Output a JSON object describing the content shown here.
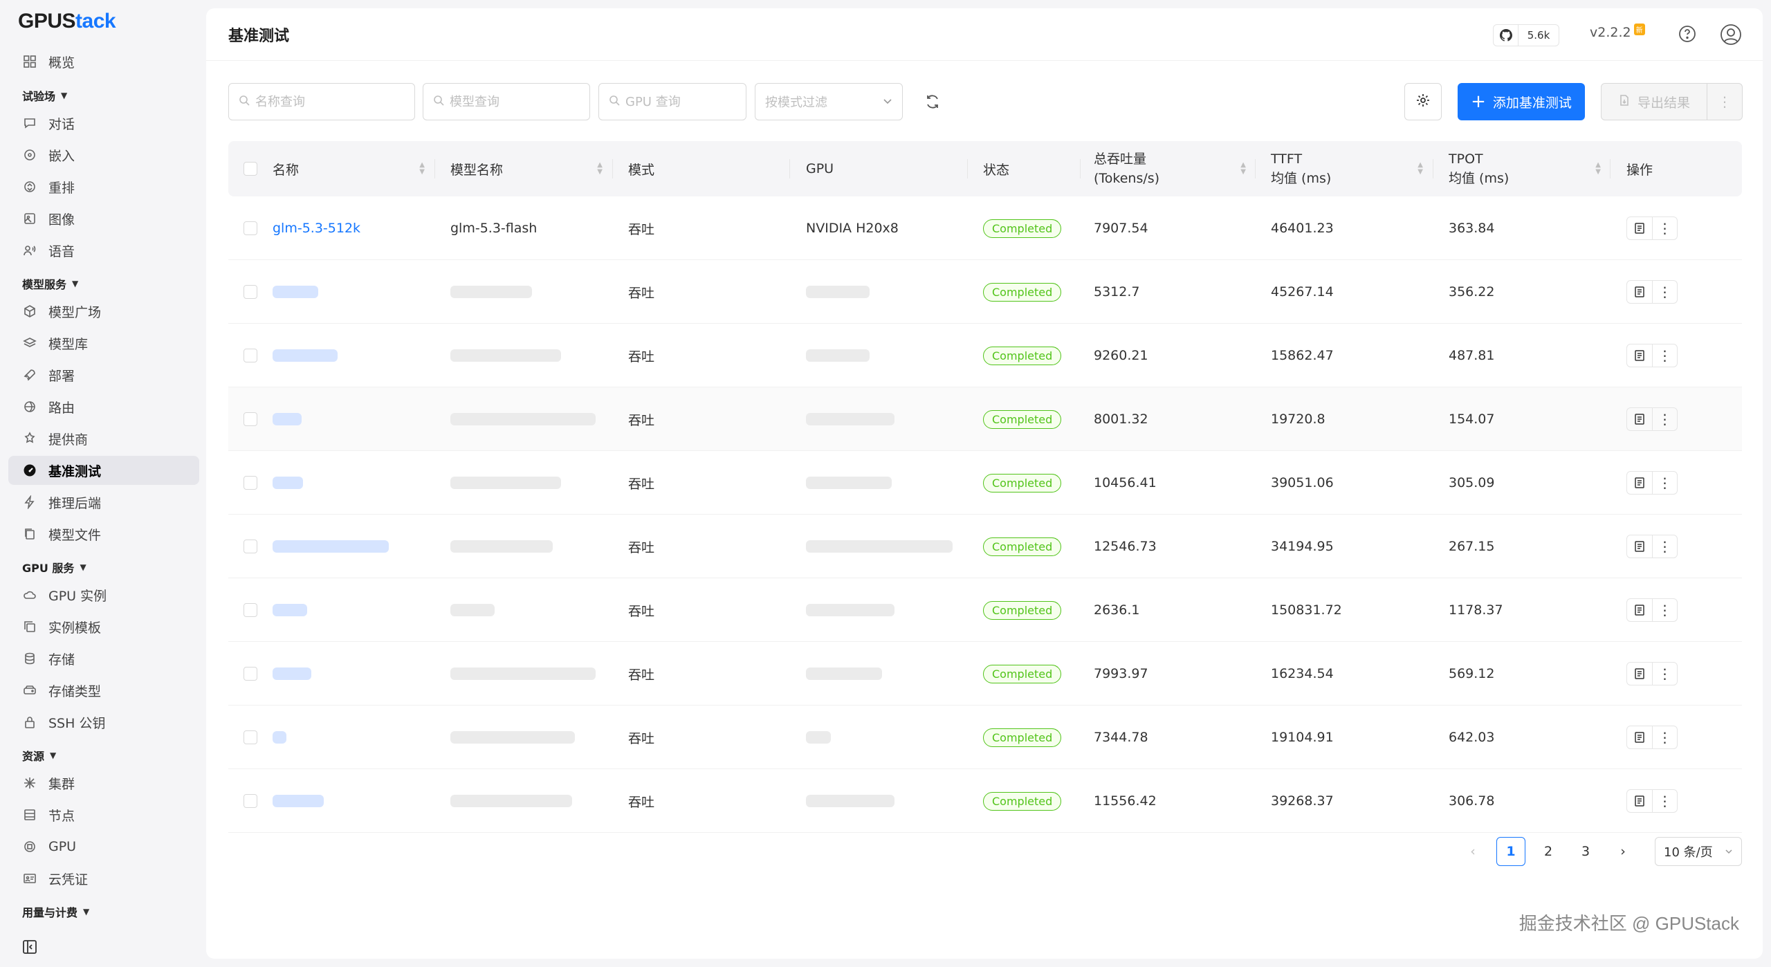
{
  "brand": {
    "logo_g": "G",
    "logo_rest1": "PUS",
    "logo_rest2": "tack"
  },
  "sidebar": {
    "overview": "概览",
    "group_playground": "试验场",
    "chat": "对话",
    "embed": "嵌入",
    "rerank": "重排",
    "image": "图像",
    "audio": "语音",
    "group_model_service": "模型服务",
    "model_square": "模型广场",
    "model_library": "模型库",
    "deploy": "部署",
    "route": "路由",
    "provider": "提供商",
    "benchmark": "基准测试",
    "inference_backend": "推理后端",
    "model_files": "模型文件",
    "group_gpu_service": "GPU 服务",
    "gpu_instance": "GPU 实例",
    "instance_template": "实例模板",
    "storage": "存储",
    "storage_type": "存储类型",
    "ssh_key": "SSH 公钥",
    "group_resources": "资源",
    "cluster": "集群",
    "node": "节点",
    "gpu": "GPU",
    "cloud_credential": "云凭证",
    "group_billing": "用量与计费"
  },
  "header": {
    "title": "基准测试",
    "github_stars": "5.6k",
    "version": "v2.2.2",
    "new_badge": "新"
  },
  "toolbar": {
    "name_placeholder": "名称查询",
    "model_placeholder": "模型查询",
    "gpu_placeholder": "GPU 查询",
    "mode_placeholder": "按模式过滤",
    "add_label": "添加基准测试",
    "export_label": "导出结果"
  },
  "table": {
    "headers": {
      "name": "名称",
      "model_name": "模型名称",
      "mode": "模式",
      "gpu": "GPU",
      "status": "状态",
      "throughput_l1": "总吞吐量",
      "throughput_l2": "(Tokens/s)",
      "ttft_l1": "TTFT",
      "ttft_l2": "均值 (ms)",
      "tpot_l1": "TPOT",
      "tpot_l2": "均值 (ms)",
      "actions": "操作"
    },
    "rows": [
      {
        "name": "glm-5.3-512k",
        "model": "glm-5.3-flash",
        "mode": "吞吐",
        "gpu": "NVIDIA H20x8",
        "status": "Completed",
        "throughput": "7907.54",
        "ttft": "46401.23",
        "tpot": "363.84"
      },
      {
        "name": "",
        "model": "",
        "mode": "吞吐",
        "gpu": "",
        "status": "Completed",
        "throughput": "5312.7",
        "ttft": "45267.14",
        "tpot": "356.22"
      },
      {
        "name": "",
        "model": "",
        "mode": "吞吐",
        "gpu": "",
        "status": "Completed",
        "throughput": "9260.21",
        "ttft": "15862.47",
        "tpot": "487.81"
      },
      {
        "name": "",
        "model": "",
        "mode": "吞吐",
        "gpu": "",
        "status": "Completed",
        "throughput": "8001.32",
        "ttft": "19720.8",
        "tpot": "154.07"
      },
      {
        "name": "",
        "model": "",
        "mode": "吞吐",
        "gpu": "",
        "status": "Completed",
        "throughput": "10456.41",
        "ttft": "39051.06",
        "tpot": "305.09"
      },
      {
        "name": "",
        "model": "",
        "mode": "吞吐",
        "gpu": "",
        "status": "Completed",
        "throughput": "12546.73",
        "ttft": "34194.95",
        "tpot": "267.15"
      },
      {
        "name": "",
        "model": "",
        "mode": "吞吐",
        "gpu": "",
        "status": "Completed",
        "throughput": "2636.1",
        "ttft": "150831.72",
        "tpot": "1178.37"
      },
      {
        "name": "",
        "model": "",
        "mode": "吞吐",
        "gpu": "",
        "status": "Completed",
        "throughput": "7993.97",
        "ttft": "16234.54",
        "tpot": "569.12"
      },
      {
        "name": "",
        "model": "",
        "mode": "吞吐",
        "gpu": "",
        "status": "Completed",
        "throughput": "7344.78",
        "ttft": "19104.91",
        "tpot": "642.03"
      },
      {
        "name": "",
        "model": "",
        "mode": "吞吐",
        "gpu": "",
        "status": "Completed",
        "throughput": "11556.42",
        "ttft": "39268.37",
        "tpot": "306.78"
      }
    ]
  },
  "pagination": {
    "pages": [
      "1",
      "2",
      "3"
    ],
    "current": "1",
    "page_size": "10 条/页"
  },
  "watermark": "掘金技术社区 @ GPUStack"
}
